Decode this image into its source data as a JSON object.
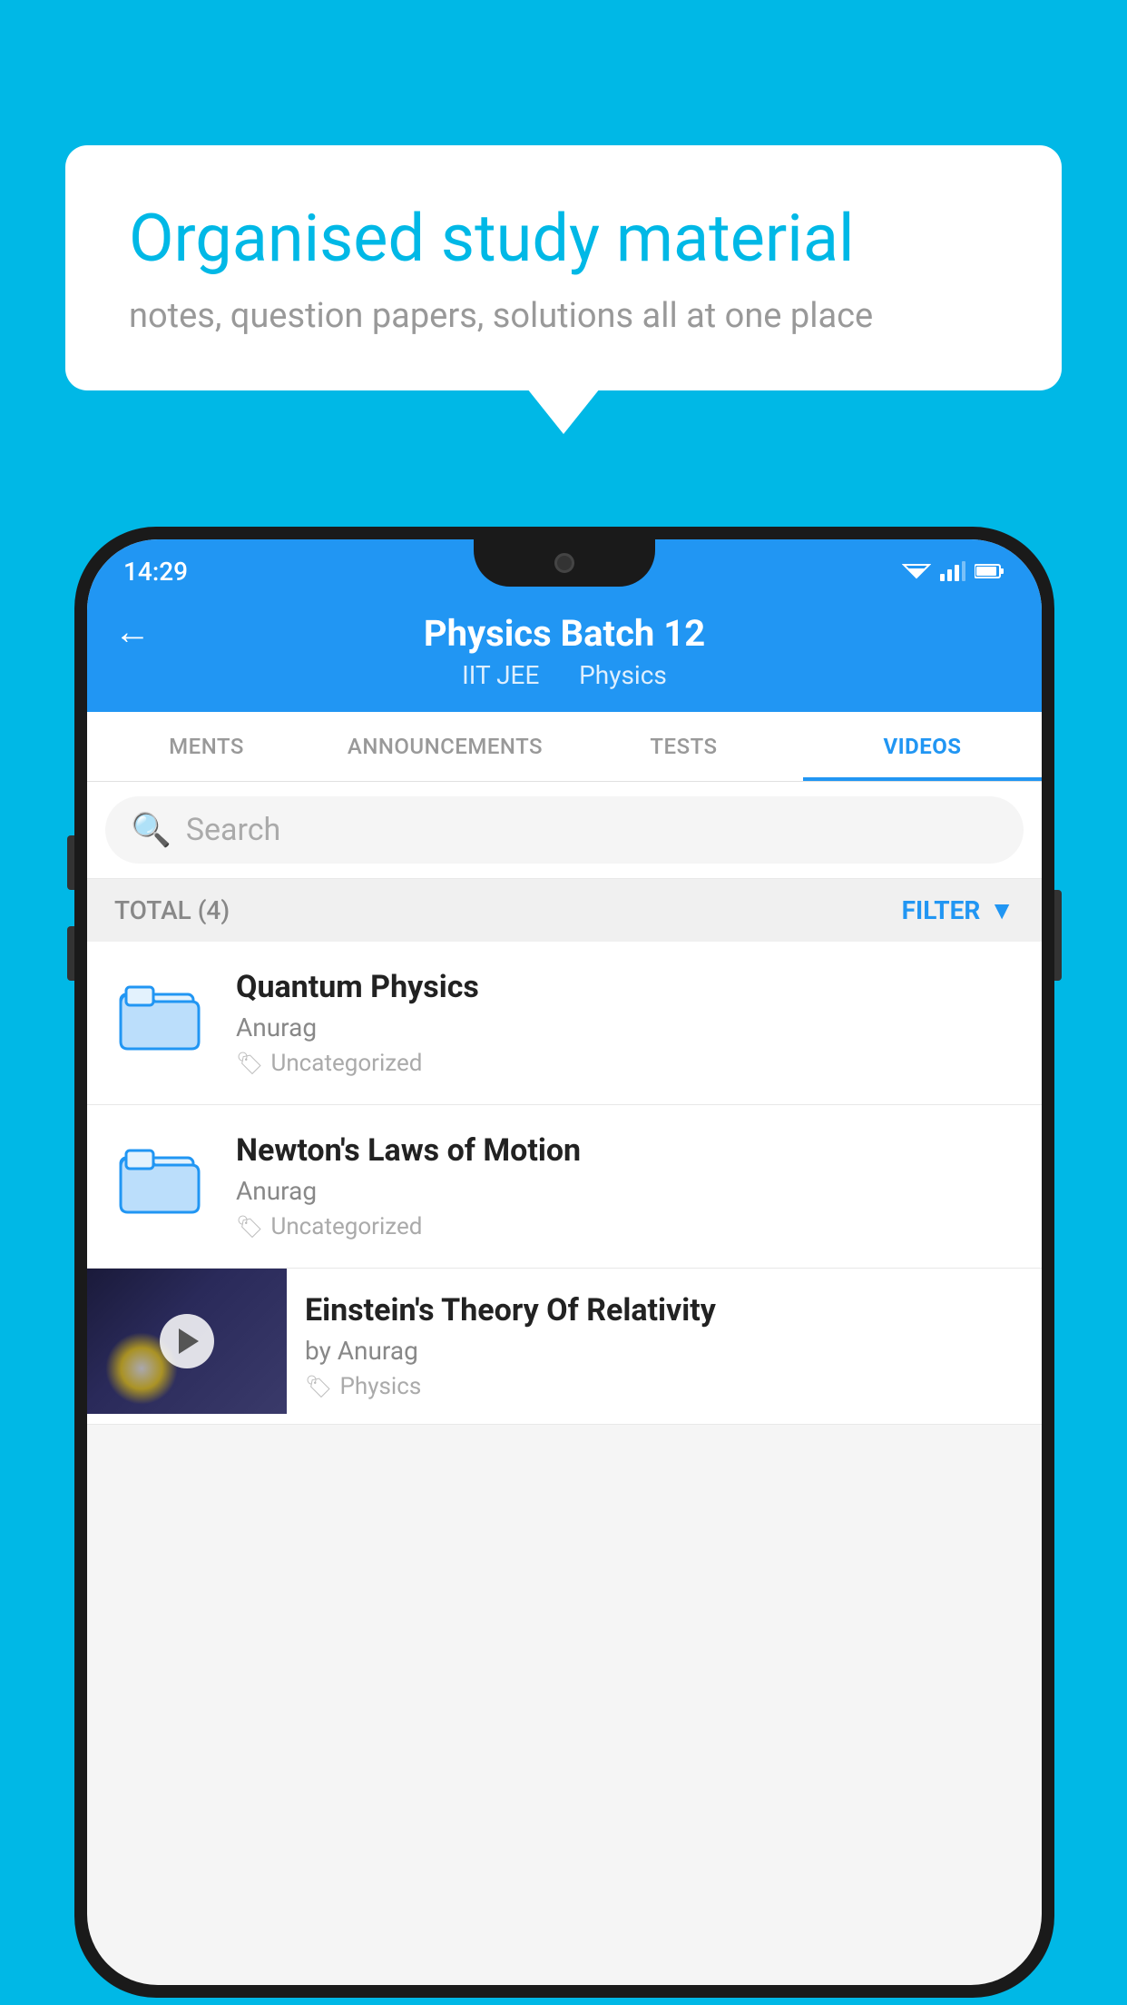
{
  "background_color": "#00b8e6",
  "bubble": {
    "title": "Organised study material",
    "subtitle": "notes, question papers, solutions all at one place"
  },
  "status_bar": {
    "time": "14:29"
  },
  "header": {
    "title": "Physics Batch 12",
    "subtitle_course": "IIT JEE",
    "subtitle_subject": "Physics"
  },
  "tabs": [
    {
      "label": "MENTS",
      "active": false
    },
    {
      "label": "ANNOUNCEMENTS",
      "active": false
    },
    {
      "label": "TESTS",
      "active": false
    },
    {
      "label": "VIDEOS",
      "active": true
    }
  ],
  "search": {
    "placeholder": "Search"
  },
  "filter_bar": {
    "total_label": "TOTAL (4)",
    "filter_label": "FILTER"
  },
  "videos": [
    {
      "title": "Quantum Physics",
      "author": "Anurag",
      "tag": "Uncategorized",
      "type": "folder"
    },
    {
      "title": "Newton's Laws of Motion",
      "author": "Anurag",
      "tag": "Uncategorized",
      "type": "folder"
    },
    {
      "title": "Einstein's Theory Of Relativity",
      "author": "by Anurag",
      "tag": "Physics",
      "type": "video"
    }
  ]
}
